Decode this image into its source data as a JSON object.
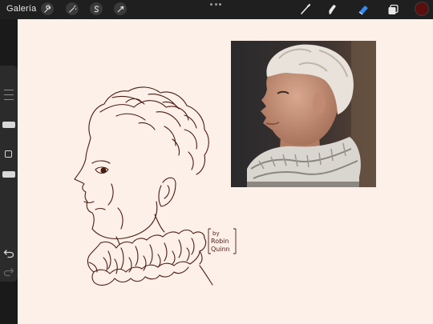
{
  "toolbar": {
    "gallery_label": "Galería",
    "left_tools": [
      "wrench-icon",
      "magic-wand-icon",
      "selection-icon",
      "transform-arrow-icon"
    ],
    "right_tools": [
      "brush-icon",
      "smudge-icon",
      "eraser-icon",
      "layers-icon"
    ],
    "current_color": "#5a0f0f"
  },
  "canvas": {
    "background_color": "#fdf0e8",
    "reference_photo": "reference-portrait",
    "sketch": "ink-sketch-portrait-with-ruff",
    "signature": {
      "lines": [
        "by",
        "Robin",
        "Quinn"
      ]
    }
  }
}
